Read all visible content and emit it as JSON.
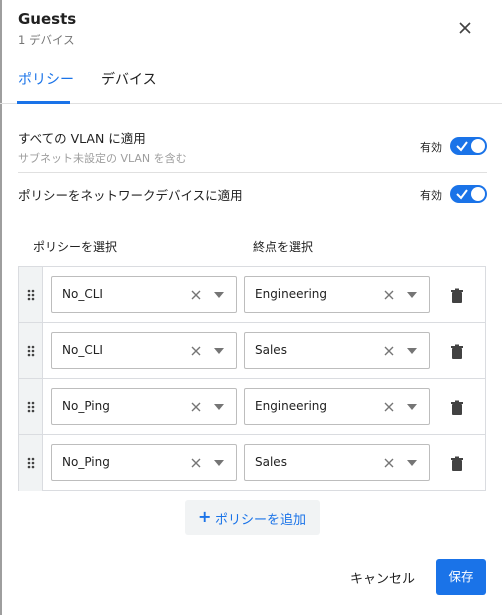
{
  "header": {
    "title": "Guests",
    "subtitle": "1 デバイス"
  },
  "tabs": [
    {
      "label": "ポリシー",
      "active": true
    },
    {
      "label": "デバイス",
      "active": false
    }
  ],
  "settings": {
    "vlan": {
      "label": "すべての VLAN に適用",
      "sub": "サブネット未設定の VLAN を含む",
      "toggle_label": "有効",
      "enabled": true
    },
    "network_device": {
      "label": "ポリシーをネットワークデバイスに適用",
      "toggle_label": "有効",
      "enabled": true
    }
  },
  "columns": {
    "policy": "ポリシーを選択",
    "endpoint": "終点を選択"
  },
  "rules": [
    {
      "policy": "No_CLI",
      "endpoint": "Engineering"
    },
    {
      "policy": "No_CLI",
      "endpoint": "Sales"
    },
    {
      "policy": "No_Ping",
      "endpoint": "Engineering"
    },
    {
      "policy": "No_Ping",
      "endpoint": "Sales"
    }
  ],
  "add_policy_label": "ポリシーを追加",
  "footer": {
    "cancel_label": "キャンセル",
    "save_label": "保存"
  },
  "colors": {
    "accent": "#1a73e8",
    "border": "#dadce0"
  },
  "icons": {
    "close": "close-icon",
    "drag": "drag-handle-icon",
    "clear": "clear-icon",
    "caret": "chevron-down-icon",
    "delete": "trash-icon",
    "add": "plus-icon",
    "check": "check-icon"
  }
}
